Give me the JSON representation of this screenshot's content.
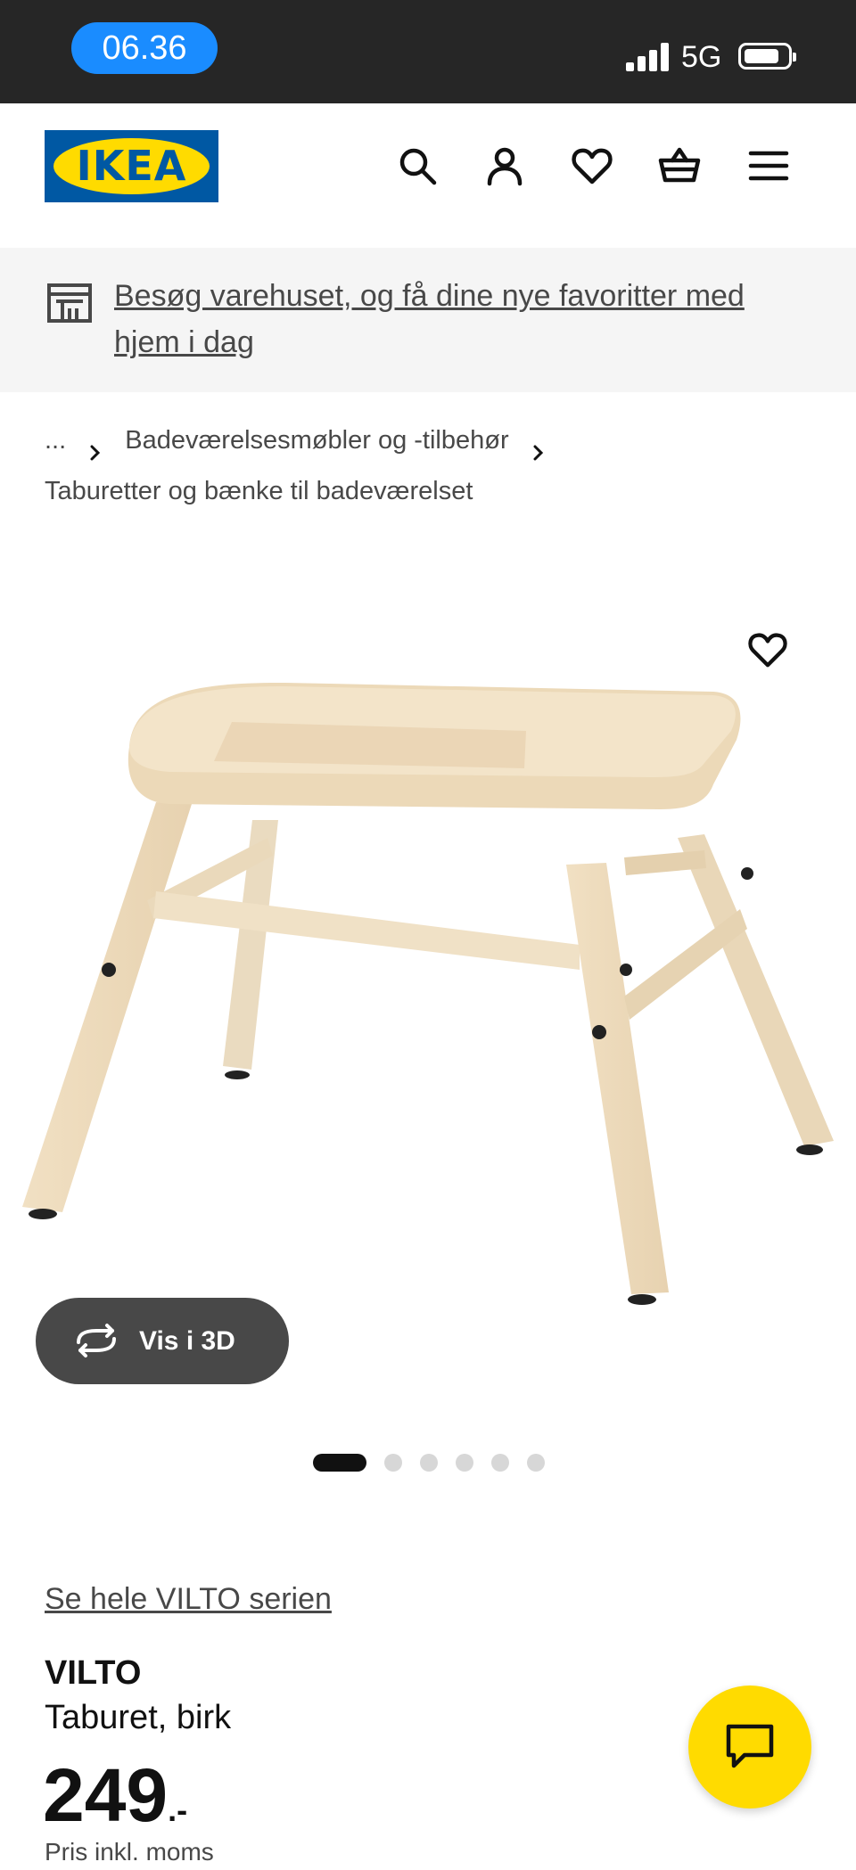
{
  "status_bar": {
    "time": "06.36",
    "network": "5G"
  },
  "header": {
    "logo_text": "IKEA",
    "icons": [
      "search-icon",
      "account-icon",
      "favourites-icon",
      "cart-icon",
      "menu-icon"
    ]
  },
  "banner": {
    "text": "Besøg varehuset, og få dine nye favoritter med hjem i dag",
    "icon": "store-icon"
  },
  "breadcrumb": {
    "ellipsis": "...",
    "level1": "Badeværelsesmøbler og -tilbehør",
    "level2": "Taburetter og bænke til badeværelset"
  },
  "gallery": {
    "view_3d_label": "Vis i 3D",
    "image_count": 6,
    "active_index": 0
  },
  "product": {
    "series_link": "Se hele VILTO serien",
    "name": "VILTO",
    "description": "Taburet, birk",
    "price": "249",
    "price_suffix": ".-",
    "price_note": "Pris inkl. moms"
  },
  "colors": {
    "ikea_blue": "#0058a3",
    "ikea_yellow": "#ffdb00",
    "status_pill": "#1a8cff"
  }
}
